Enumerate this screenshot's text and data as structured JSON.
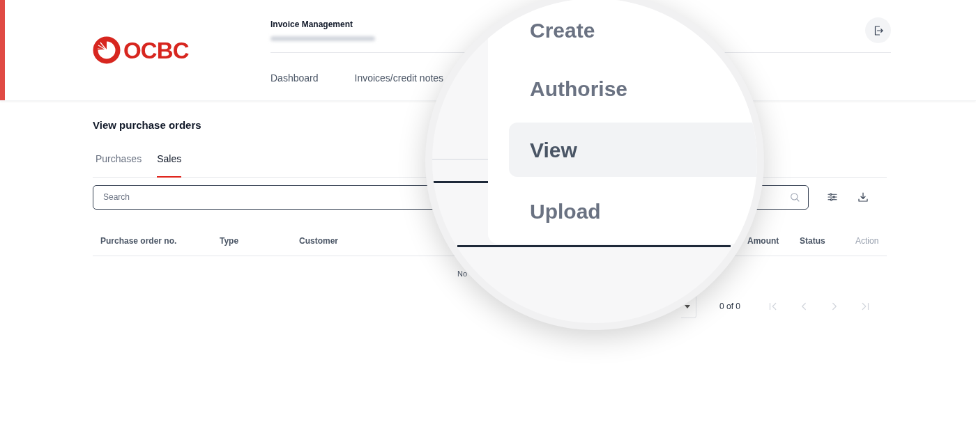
{
  "brand": {
    "logo_text": "OCBC"
  },
  "header": {
    "app_title": "Invoice Management",
    "nav": [
      {
        "label": "Dashboard"
      },
      {
        "label": "Invoices/credit notes"
      }
    ]
  },
  "page": {
    "title": "View purchase orders",
    "tabs": [
      {
        "label": "Purchases",
        "selected": false
      },
      {
        "label": "Sales",
        "selected": true
      }
    ],
    "search": {
      "placeholder": "Search"
    },
    "table": {
      "columns": [
        "Purchase order no.",
        "Type",
        "Customer",
        "Amount",
        "Status",
        "Action"
      ],
      "empty_message": "No"
    },
    "pagination": {
      "range": "0 of 0"
    }
  },
  "magnifier": {
    "menu": [
      {
        "label": "Create",
        "selected": false
      },
      {
        "label": "Authorise",
        "selected": false
      },
      {
        "label": "View",
        "selected": true
      },
      {
        "label": "Upload",
        "selected": false
      }
    ]
  }
}
